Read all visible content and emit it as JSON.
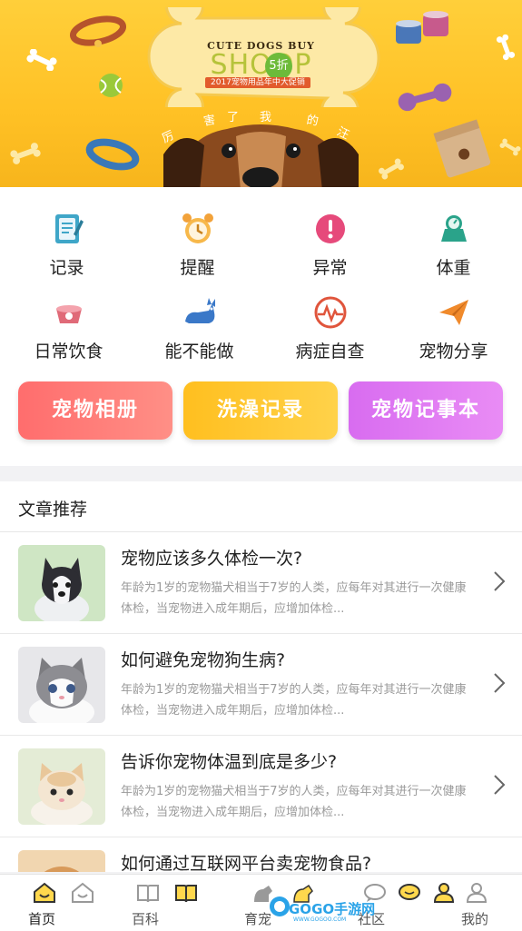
{
  "banner": {
    "brand_top": "CUTE DOGS BUY",
    "brand_main": "SHOOP",
    "badge": "5折",
    "badge_sub": "全场包邮",
    "sub_ribbon": "2017宠物用品年中大促销",
    "caption_chars": [
      "厉",
      "害",
      "了",
      "我",
      "的",
      "汪"
    ]
  },
  "functions": [
    {
      "label": "记录",
      "icon": "notebook-icon"
    },
    {
      "label": "提醒",
      "icon": "alarm-clock-icon"
    },
    {
      "label": "异常",
      "icon": "exclamation-icon"
    },
    {
      "label": "体重",
      "icon": "scale-icon"
    },
    {
      "label": "日常饮食",
      "icon": "food-bowl-icon"
    },
    {
      "label": "能不能做",
      "icon": "cat-icon"
    },
    {
      "label": "病症自查",
      "icon": "heartbeat-icon"
    },
    {
      "label": "宠物分享",
      "icon": "paper-plane-icon"
    }
  ],
  "pills": {
    "album": "宠物相册",
    "bath": "洗澡记录",
    "memo": "宠物记事本"
  },
  "articles": {
    "section_title": "文章推荐",
    "items": [
      {
        "title": "宠物应该多久体检一次?",
        "desc": "年龄为1岁的宠物猫犬相当于7岁的人类，应每年对其进行一次健康体检，当宠物进入成年期后，应增加体检..."
      },
      {
        "title": "如何避免宠物狗生病?",
        "desc": "年龄为1岁的宠物猫犬相当于7岁的人类，应每年对其进行一次健康体检，当宠物进入成年期后，应增加体检..."
      },
      {
        "title": "告诉你宠物体温到底是多少?",
        "desc": "年龄为1岁的宠物猫犬相当于7岁的人类，应每年对其进行一次健康体检，当宠物进入成年期后，应增加体检..."
      },
      {
        "title": "如何通过互联网平台卖宠物食品?",
        "desc": ""
      }
    ]
  },
  "tabbar": {
    "home": "首页",
    "encyclopedia": "百科",
    "raise": "育宠",
    "community": "社区",
    "mine": "我的"
  },
  "watermark": {
    "text": "GOGO手游网",
    "url": "WWW.GOGOO.COM"
  },
  "colors": {
    "banner_yellow": "#ffc125",
    "pill_red": "#ff6d6d",
    "pill_yellow": "#ffbf1f",
    "pill_purple": "#d86cf0",
    "accent_teal": "#2aa38a"
  }
}
